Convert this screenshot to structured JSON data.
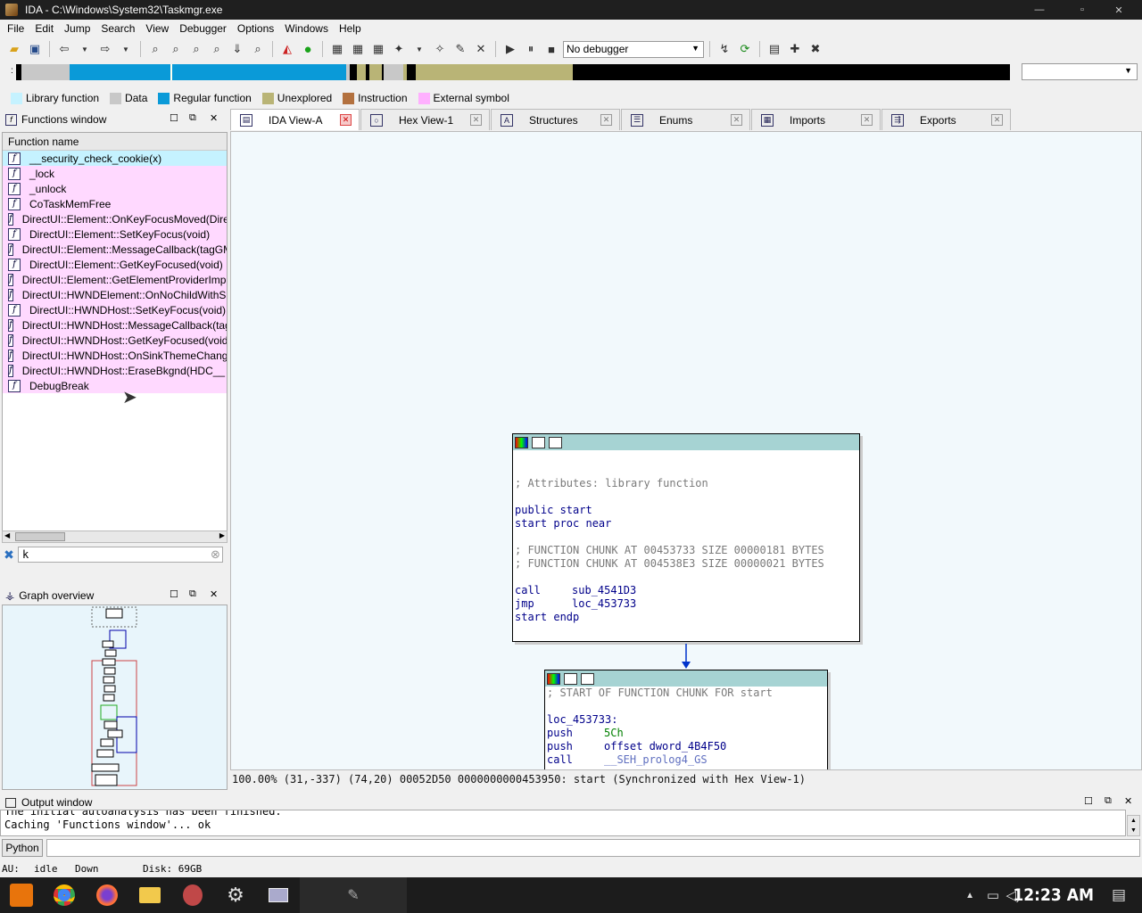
{
  "window": {
    "title": "IDA - C:\\Windows\\System32\\Taskmgr.exe"
  },
  "menu": [
    "File",
    "Edit",
    "Jump",
    "Search",
    "View",
    "Debugger",
    "Options",
    "Windows",
    "Help"
  ],
  "toolbar": {
    "debugger_select": "No debugger"
  },
  "legend": [
    {
      "label": "Library function",
      "color": "#c5f2ff"
    },
    {
      "label": "Data",
      "color": "#c8c8c8"
    },
    {
      "label": "Regular function",
      "color": "#0a9ad8"
    },
    {
      "label": "Unexplored",
      "color": "#b9b476"
    },
    {
      "label": "Instruction",
      "color": "#b3713f"
    },
    {
      "label": "External symbol",
      "color": "#ffb0ff"
    }
  ],
  "functions_window": {
    "title": "Functions window",
    "column": "Function name",
    "rows": [
      "__security_check_cookie(x)",
      "_lock",
      "_unlock",
      "CoTaskMemFree",
      "DirectUI::Element::OnKeyFocusMoved(DirectUI",
      "DirectUI::Element::SetKeyFocus(void)",
      "DirectUI::Element::MessageCallback(tagGMSG *",
      "DirectUI::Element::GetKeyFocused(void)",
      "DirectUI::Element::GetElementProviderImpl(Dire",
      "DirectUI::HWNDElement::OnNoChildWithShortcut",
      "DirectUI::HWNDHost::SetKeyFocus(void)",
      "DirectUI::HWNDHost::MessageCallback(tagGMS",
      "DirectUI::HWNDHost::GetKeyFocused(void)",
      "DirectUI::HWNDHost::OnSinkThemeChanged(ui",
      "DirectUI::HWNDHost::EraseBkgnd(HDC__ *,lon",
      "DebugBreak"
    ],
    "filter_value": "k"
  },
  "graph_overview": {
    "title": "Graph overview"
  },
  "tabs": [
    {
      "label": "IDA View-A",
      "glyph": "▤"
    },
    {
      "label": "Hex View-1",
      "glyph": "○"
    },
    {
      "label": "Structures",
      "glyph": "A"
    },
    {
      "label": "Enums",
      "glyph": "☰"
    },
    {
      "label": "Imports",
      "glyph": "▦"
    },
    {
      "label": "Exports",
      "glyph": "⇶"
    }
  ],
  "node1": {
    "comment": "; Attributes: library function",
    "l1": "public start",
    "l2": "start proc near",
    "c1": "; FUNCTION CHUNK AT 00453733 SIZE 00000181 BYTES",
    "c2": "; FUNCTION CHUNK AT 004538E3 SIZE 00000021 BYTES",
    "op1": "call",
    "arg1": "sub_4541D3",
    "op2": "jmp",
    "arg2": "loc_453733",
    "l3": "start endp"
  },
  "node2": {
    "comment": "; START OF FUNCTION CHUNK FOR start",
    "label": "loc_453733:",
    "op1": "push",
    "arg1": "5Ch",
    "op2": "push",
    "arg2": "offset dword_4B4F50",
    "op3": "call",
    "arg3": "__SEH_prolog4_GS"
  },
  "graph_status": "100.00% (31,-337) (74,20) 00052D50 0000000000453950: start (Synchronized with Hex View-1)",
  "output": {
    "title": "Output window",
    "lines": [
      "The initial autoanalysis has been finished.",
      "Caching 'Functions window'... ok"
    ],
    "python_button": "Python"
  },
  "statusbar": {
    "au": "AU:",
    "state": "idle",
    "dir": "Down",
    "disk": "Disk: 69GB"
  },
  "clock": "12:23 AM"
}
